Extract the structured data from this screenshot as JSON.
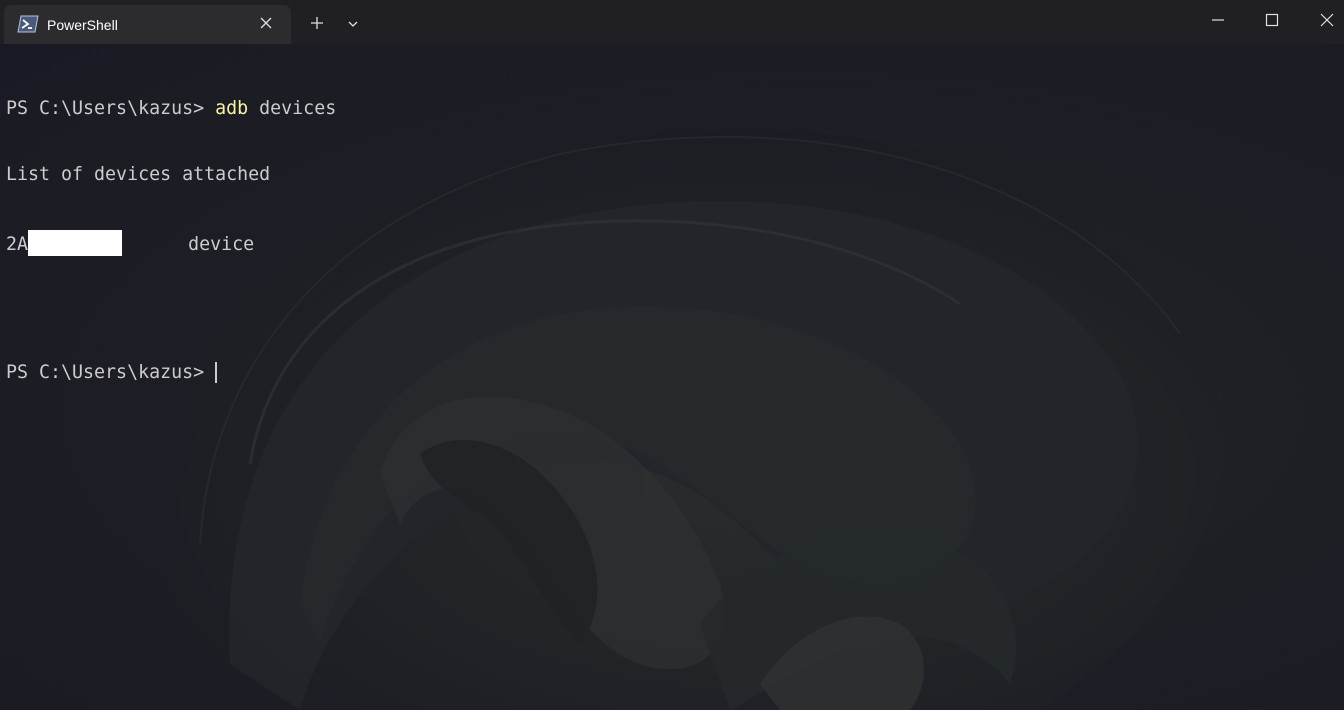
{
  "window": {
    "tab_title": "PowerShell",
    "tab_icon": "powershell-icon",
    "new_tab_icon": "plus-icon",
    "dropdown_icon": "chevron-down-icon",
    "minimize_icon": "minimize-icon",
    "maximize_icon": "maximize-icon",
    "close_icon": "close-icon"
  },
  "terminal": {
    "line1": {
      "prompt": "PS C:\\Users\\kazus> ",
      "command": "adb",
      "args": " devices"
    },
    "line2": "List of devices attached",
    "line3": {
      "serial_visible": "2A",
      "gap": "      ",
      "state": "device"
    },
    "line5": {
      "prompt": "PS C:\\Users\\kazus> "
    }
  },
  "colors": {
    "titlebar": "#202024",
    "tab": "#2c2c2e",
    "text": "#cccccc",
    "command": "#f9f1a5"
  }
}
